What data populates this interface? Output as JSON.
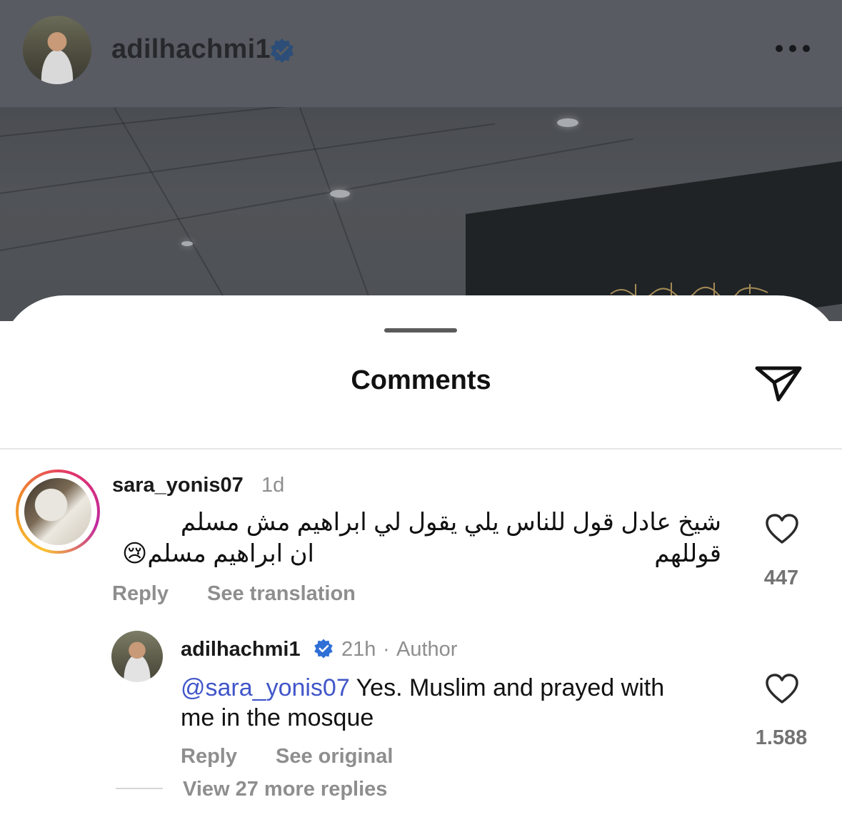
{
  "post": {
    "username": "adilhachmi1"
  },
  "sheet": {
    "title": "Comments"
  },
  "comments": [
    {
      "username": "sara_yonis07",
      "time": "1d",
      "text_line1": "شيخ عادل قول للناس يلي يقول لي ابراهيم مش مسلم قوللهم",
      "text_line2": "ان ابراهيم مسلم😢",
      "reply_label": "Reply",
      "translate_label": "See translation",
      "likes": "447"
    },
    {
      "username": "adilhachmi1",
      "time": "21h",
      "separator": "·",
      "author_label": "Author",
      "mention": "@sara_yonis07",
      "text_line1_rest": " Yes. Muslim and prayed with",
      "text_line2": "me in the mosque",
      "reply_label": "Reply",
      "original_label": "See original",
      "likes": "1.588"
    }
  ],
  "thread": {
    "view_more_label": "View 27 more replies"
  },
  "colors": {
    "verified": "#2f6fd6",
    "mention": "#4156c9",
    "muted": "#8e8e8e"
  },
  "icons": [
    "verified-badge-icon",
    "more-options-icon",
    "share-icon",
    "heart-icon"
  ]
}
